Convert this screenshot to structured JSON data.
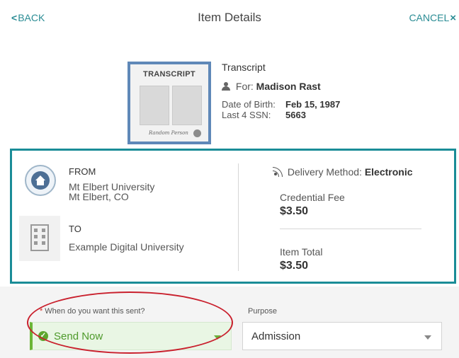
{
  "header": {
    "back_chevron": "<",
    "back_label": "BACK",
    "title": "Item Details",
    "cancel_label": "CANCEL",
    "cancel_icon": "×"
  },
  "item": {
    "thumbnail_title": "TRANSCRIPT",
    "thumbnail_signature": "Random Person",
    "name": "Transcript",
    "for_label": "For:",
    "for_name": "Madison Rast",
    "dob_label": "Date of Birth:",
    "dob_value": "Feb 15, 1987",
    "ssn_label": "Last 4 SSN:",
    "ssn_value": "5663"
  },
  "details": {
    "from_label": "FROM",
    "from_name": "Mt Elbert University",
    "from_location": "Mt Elbert, CO",
    "to_label": "TO",
    "to_name": "Example Digital University",
    "delivery_label": "Delivery Method:",
    "delivery_value": "Electronic",
    "fee_label": "Credential Fee",
    "fee_value": "$3.50",
    "total_label": "Item Total",
    "total_value": "$3.50"
  },
  "form": {
    "when_required_mark": "*",
    "when_label": "When do you want this sent?",
    "when_value": "Send Now",
    "purpose_label": "Purpose",
    "purpose_value": "Admission"
  },
  "icons": {
    "person": "person-icon",
    "signal": "signal-icon",
    "seal": "university-seal-icon",
    "building": "building-icon",
    "check": "check-icon",
    "caret": "chevron-down-icon"
  },
  "colors": {
    "accent": "#1a8c97",
    "link": "#2a8c94",
    "success": "#5ea72f",
    "annotation": "#c9202d"
  }
}
